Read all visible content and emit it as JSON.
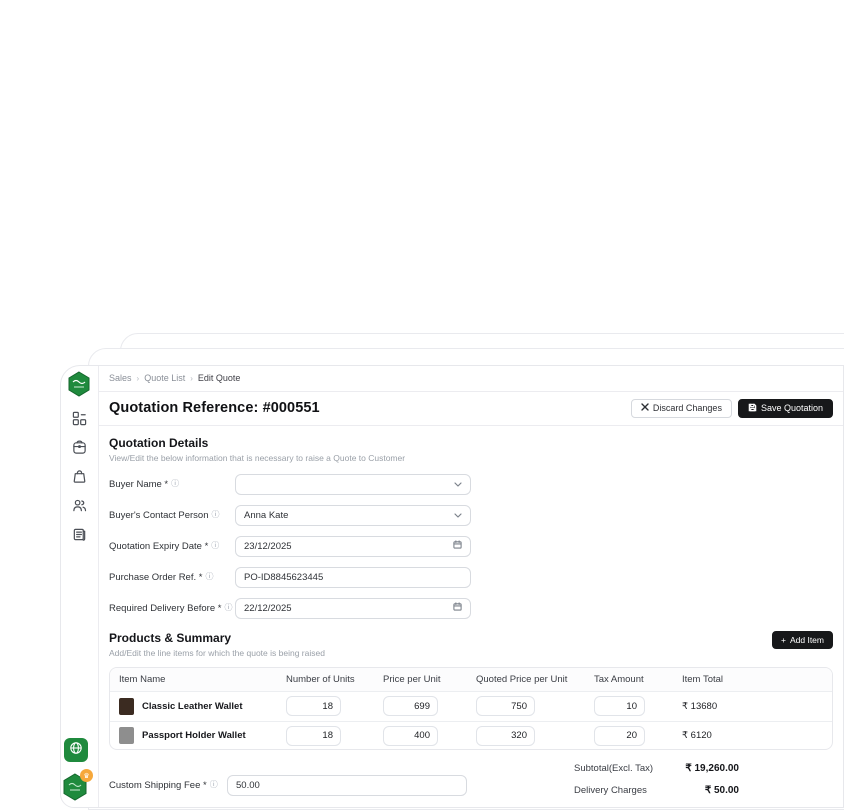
{
  "colors": {
    "brand_green": "#1f8a3d",
    "button_dark": "#17181a",
    "badge_orange": "#f6a83b",
    "thumb1": "#3b2b21",
    "thumb2": "#8e8e8e"
  },
  "breadcrumb": {
    "items": [
      "Sales",
      "Quote List",
      "Edit Quote"
    ]
  },
  "header": {
    "title": "Quotation Reference: #000551",
    "discard_label": "Discard Changes",
    "save_label": "Save Quotation"
  },
  "details": {
    "title": "Quotation Details",
    "subtitle": "View/Edit the below information that is necessary to raise a Quote to Customer",
    "fields": [
      {
        "label": "Buyer Name *",
        "value": ""
      },
      {
        "label": "Buyer's Contact Person",
        "value": "Anna Kate"
      },
      {
        "label": "Quotation Expiry Date *",
        "value": "23/12/2025"
      },
      {
        "label": "Purchase Order Ref. *",
        "value": "PO-ID8845623445"
      },
      {
        "label": "Required Delivery Before *",
        "value": "22/12/2025"
      }
    ]
  },
  "products": {
    "title": "Products & Summary",
    "subtitle": "Add/Edit the line items for which the quote is being raised",
    "add_item_label": "Add Item",
    "table": {
      "headers": [
        "Item Name",
        "Number of Units",
        "Price per Unit",
        "Quoted Price per Unit",
        "Tax Amount",
        "Item Total"
      ],
      "rows": [
        {
          "name": "Classic Leather Wallet",
          "units": "18",
          "price": "699",
          "quoted": "750",
          "tax": "10",
          "total": "₹ 13680"
        },
        {
          "name": "Passport Holder Wallet",
          "units": "18",
          "price": "400",
          "quoted": "320",
          "tax": "20",
          "total": "₹ 6120"
        }
      ]
    },
    "shipping": {
      "label": "Custom Shipping Fee *",
      "value": "50.00"
    },
    "summary": [
      {
        "label": "Subtotal(Excl. Tax)",
        "value": "₹ 19,260.00"
      },
      {
        "label": "Delivery Charges",
        "value": "₹ 50.00"
      }
    ]
  }
}
